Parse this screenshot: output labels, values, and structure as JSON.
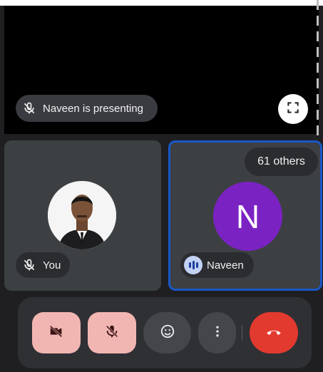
{
  "presentation": {
    "presenting_text": "Naveen is presenting"
  },
  "tiles": {
    "self": {
      "name": "You"
    },
    "participant": {
      "name": "Naveen",
      "initial": "N"
    },
    "others_label": "61 others"
  },
  "colors": {
    "end_call": "#e33a2f",
    "muted_button": "#f2b6b2",
    "active_speaker_border": "#1a57c6",
    "avatar_purple": "#7b22c2"
  },
  "controls": {
    "camera": "camera-off-icon",
    "mic": "mic-off-icon",
    "reactions": "emoji-icon",
    "more": "more-vert-icon",
    "end": "end-call-icon"
  }
}
